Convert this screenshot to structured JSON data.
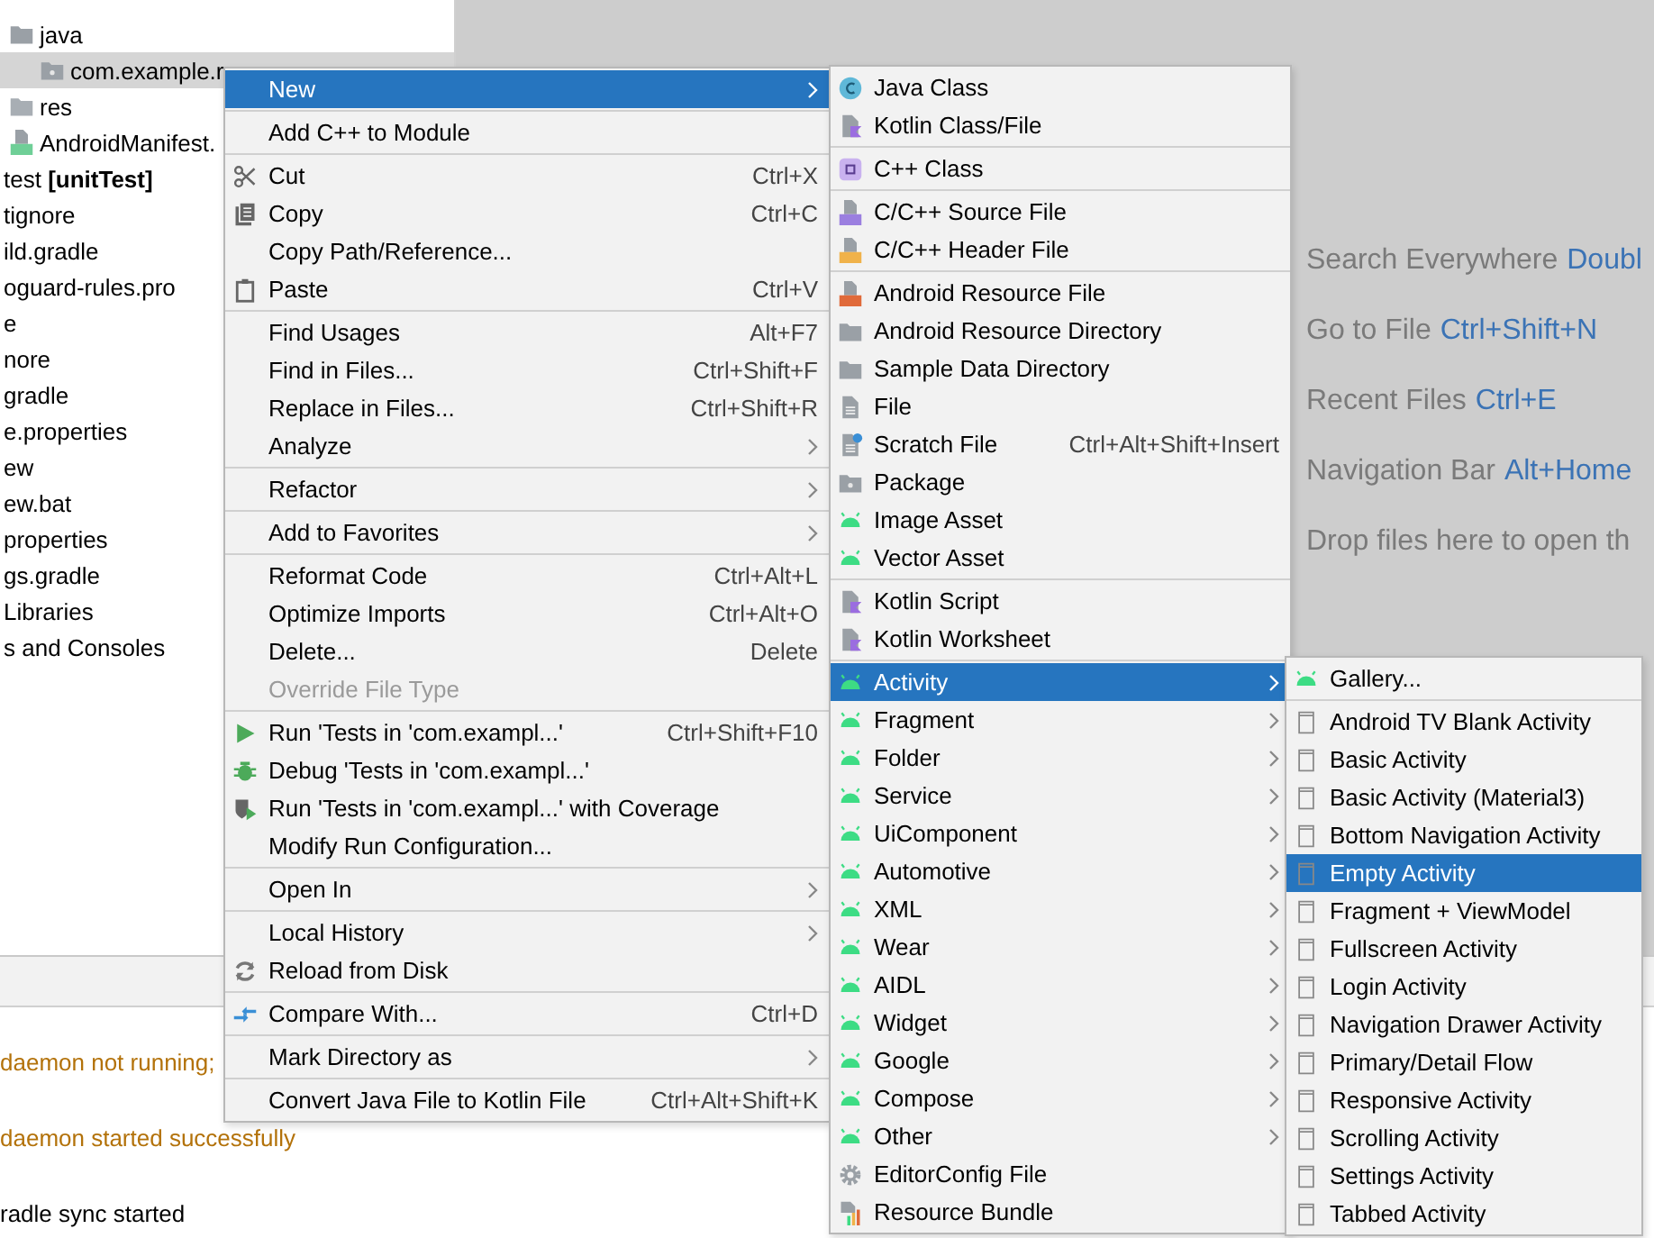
{
  "project_tree": {
    "items": [
      {
        "label": "java",
        "kind": "folder",
        "selected": false,
        "children": [
          {
            "label": "com.example.r",
            "kind": "package",
            "selected": true
          }
        ]
      },
      {
        "label": "res",
        "kind": "resfolder",
        "selected": false
      },
      {
        "label": "AndroidManifest.",
        "kind": "manifest",
        "selected": false
      },
      {
        "label": "test **[unitTest]**",
        "selected": false
      },
      {
        "label": "tignore",
        "selected": false
      },
      {
        "label": "ild.gradle",
        "selected": false
      },
      {
        "label": "oguard-rules.pro",
        "selected": false
      },
      {
        "label": "e",
        "selected": false
      },
      {
        "label": "nore",
        "selected": false
      },
      {
        "label": "gradle",
        "selected": false
      },
      {
        "label": "e.properties",
        "selected": false
      },
      {
        "label": "ew",
        "selected": false
      },
      {
        "label": "ew.bat",
        "selected": false
      },
      {
        "label": "properties",
        "selected": false
      },
      {
        "label": "gs.gradle",
        "selected": false
      },
      {
        "label": "Libraries",
        "selected": false
      },
      {
        "label": "s and Consoles",
        "selected": false
      }
    ]
  },
  "editor_hints": [
    {
      "label": "Search Everywhere",
      "shortcut": "Doubl"
    },
    {
      "label": "Go to File",
      "shortcut": "Ctrl+Shift+N"
    },
    {
      "label": "Recent Files",
      "shortcut": "Ctrl+E"
    },
    {
      "label": "Navigation Bar",
      "shortcut": "Alt+Home"
    },
    {
      "label": "Drop files here to open th"
    }
  ],
  "build_output": {
    "lines": [
      {
        "text": "daemon not running;",
        "kind": "warning"
      },
      {
        "text": "daemon started successfully",
        "kind": "warning"
      },
      {
        "text": "radle sync started",
        "kind": "plain"
      }
    ]
  },
  "context_menu": {
    "items": [
      {
        "kind": "none",
        "label": "New",
        "submenu": true,
        "selected": true,
        "disabled": false
      },
      {
        "kind": "separator"
      },
      {
        "kind": "none",
        "label": "Add C++ to Module",
        "submenu": false,
        "selected": false,
        "disabled": false
      },
      {
        "kind": "separator"
      },
      {
        "kind": "scissors",
        "label": "Cut",
        "shortcut": "Ctrl+X",
        "submenu": false,
        "selected": false,
        "disabled": false
      },
      {
        "kind": "copy",
        "label": "Copy",
        "shortcut": "Ctrl+C",
        "submenu": false,
        "selected": false,
        "disabled": false
      },
      {
        "kind": "none",
        "label": "Copy Path/Reference...",
        "submenu": false,
        "selected": false,
        "disabled": false
      },
      {
        "kind": "clipboard",
        "label": "Paste",
        "shortcut": "Ctrl+V",
        "submenu": false,
        "selected": false,
        "disabled": false
      },
      {
        "kind": "separator"
      },
      {
        "kind": "none",
        "label": "Find Usages",
        "shortcut": "Alt+F7",
        "submenu": false,
        "selected": false,
        "disabled": false
      },
      {
        "kind": "none",
        "label": "Find in Files...",
        "shortcut": "Ctrl+Shift+F",
        "submenu": false,
        "selected": false,
        "disabled": false
      },
      {
        "kind": "none",
        "label": "Replace in Files...",
        "shortcut": "Ctrl+Shift+R",
        "submenu": false,
        "selected": false,
        "disabled": false
      },
      {
        "kind": "none",
        "label": "Analyze",
        "submenu": true,
        "selected": false,
        "disabled": false
      },
      {
        "kind": "separator"
      },
      {
        "kind": "none",
        "label": "Refactor",
        "submenu": true,
        "selected": false,
        "disabled": false
      },
      {
        "kind": "separator"
      },
      {
        "kind": "none",
        "label": "Add to Favorites",
        "submenu": true,
        "selected": false,
        "disabled": false
      },
      {
        "kind": "separator"
      },
      {
        "kind": "none",
        "label": "Reformat Code",
        "shortcut": "Ctrl+Alt+L",
        "submenu": false,
        "selected": false,
        "disabled": false
      },
      {
        "kind": "none",
        "label": "Optimize Imports",
        "shortcut": "Ctrl+Alt+O",
        "submenu": false,
        "selected": false,
        "disabled": false
      },
      {
        "kind": "none",
        "label": "Delete...",
        "shortcut": "Delete",
        "submenu": false,
        "selected": false,
        "disabled": false
      },
      {
        "kind": "none",
        "label": "Override File Type",
        "submenu": false,
        "selected": false,
        "disabled": true
      },
      {
        "kind": "separator"
      },
      {
        "kind": "run",
        "label": "Run 'Tests in 'com.exampl...'",
        "shortcut": "Ctrl+Shift+F10",
        "submenu": false,
        "selected": false,
        "disabled": false
      },
      {
        "kind": "bug",
        "label": "Debug 'Tests in 'com.exampl...'",
        "submenu": false,
        "selected": false,
        "disabled": false
      },
      {
        "kind": "coverage",
        "label": "Run 'Tests in 'com.exampl...' with Coverage",
        "submenu": false,
        "selected": false,
        "disabled": false
      },
      {
        "kind": "none",
        "label": "Modify Run Configuration...",
        "submenu": false,
        "selected": false,
        "disabled": false
      },
      {
        "kind": "separator"
      },
      {
        "kind": "none",
        "label": "Open In",
        "submenu": true,
        "selected": false,
        "disabled": false
      },
      {
        "kind": "separator"
      },
      {
        "kind": "none",
        "label": "Local History",
        "submenu": true,
        "selected": false,
        "disabled": false
      },
      {
        "kind": "reload",
        "label": "Reload from Disk",
        "submenu": false,
        "selected": false,
        "disabled": false
      },
      {
        "kind": "separator"
      },
      {
        "kind": "compare",
        "label": "Compare With...",
        "shortcut": "Ctrl+D",
        "submenu": false,
        "selected": false,
        "disabled": false
      },
      {
        "kind": "separator"
      },
      {
        "kind": "none",
        "label": "Mark Directory as",
        "submenu": true,
        "selected": false,
        "disabled": false
      },
      {
        "kind": "separator"
      },
      {
        "kind": "none",
        "label": "Convert Java File to Kotlin File",
        "shortcut": "Ctrl+Alt+Shift+K",
        "submenu": false,
        "selected": false,
        "disabled": false
      }
    ]
  },
  "new_submenu": {
    "items": [
      {
        "kind": "javaclass",
        "label": "Java Class",
        "submenu": false,
        "selected": false
      },
      {
        "kind": "kotlin",
        "label": "Kotlin Class/File",
        "submenu": false,
        "selected": false
      },
      {
        "kind": "separator"
      },
      {
        "kind": "cppclass",
        "label": "C++ Class",
        "submenu": false,
        "selected": false
      },
      {
        "kind": "separator"
      },
      {
        "kind": "cppsource",
        "label": "C/C++ Source File",
        "submenu": false,
        "selected": false
      },
      {
        "kind": "cppheader",
        "label": "C/C++ Header File",
        "submenu": false,
        "selected": false
      },
      {
        "kind": "separator"
      },
      {
        "kind": "resfile",
        "label": "Android Resource File",
        "submenu": false,
        "selected": false
      },
      {
        "kind": "folder",
        "label": "Android Resource Directory",
        "submenu": false,
        "selected": false
      },
      {
        "kind": "folder",
        "label": "Sample Data Directory",
        "submenu": false,
        "selected": false
      },
      {
        "kind": "file",
        "label": "File",
        "submenu": false,
        "selected": false
      },
      {
        "kind": "scratch",
        "label": "Scratch File",
        "shortcut": "Ctrl+Alt+Shift+Insert",
        "submenu": false,
        "selected": false
      },
      {
        "kind": "package",
        "label": "Package",
        "submenu": false,
        "selected": false
      },
      {
        "kind": "android",
        "label": "Image Asset",
        "submenu": false,
        "selected": false
      },
      {
        "kind": "android",
        "label": "Vector Asset",
        "submenu": false,
        "selected": false
      },
      {
        "kind": "separator"
      },
      {
        "kind": "kotlin",
        "label": "Kotlin Script",
        "submenu": false,
        "selected": false
      },
      {
        "kind": "kotlin",
        "label": "Kotlin Worksheet",
        "submenu": false,
        "selected": false
      },
      {
        "kind": "separator"
      },
      {
        "kind": "android",
        "label": "Activity",
        "submenu": true,
        "selected": true
      },
      {
        "kind": "android",
        "label": "Fragment",
        "submenu": true,
        "selected": false
      },
      {
        "kind": "android",
        "label": "Folder",
        "submenu": true,
        "selected": false
      },
      {
        "kind": "android",
        "label": "Service",
        "submenu": true,
        "selected": false
      },
      {
        "kind": "android",
        "label": "UiComponent",
        "submenu": true,
        "selected": false
      },
      {
        "kind": "android",
        "label": "Automotive",
        "submenu": true,
        "selected": false
      },
      {
        "kind": "android",
        "label": "XML",
        "submenu": true,
        "selected": false
      },
      {
        "kind": "android",
        "label": "Wear",
        "submenu": true,
        "selected": false
      },
      {
        "kind": "android",
        "label": "AIDL",
        "submenu": true,
        "selected": false
      },
      {
        "kind": "android",
        "label": "Widget",
        "submenu": true,
        "selected": false
      },
      {
        "kind": "android",
        "label": "Google",
        "submenu": true,
        "selected": false
      },
      {
        "kind": "android",
        "label": "Compose",
        "submenu": true,
        "selected": false
      },
      {
        "kind": "android",
        "label": "Other",
        "submenu": true,
        "selected": false
      },
      {
        "kind": "gear",
        "label": "EditorConfig File",
        "submenu": false,
        "selected": false
      },
      {
        "kind": "bundle",
        "label": "Resource Bundle",
        "submenu": false,
        "selected": false
      }
    ]
  },
  "activity_submenu": {
    "items": [
      {
        "kind": "android",
        "label": "Gallery...",
        "selected": false
      },
      {
        "kind": "separator"
      },
      {
        "kind": "layout",
        "label": "Android TV Blank Activity",
        "selected": false
      },
      {
        "kind": "layout",
        "label": "Basic Activity",
        "selected": false
      },
      {
        "kind": "layout",
        "label": "Basic Activity (Material3)",
        "selected": false
      },
      {
        "kind": "layout",
        "label": "Bottom Navigation Activity",
        "selected": false
      },
      {
        "kind": "layout",
        "label": "Empty Activity",
        "selected": true
      },
      {
        "kind": "layout",
        "label": "Fragment + ViewModel",
        "selected": false
      },
      {
        "kind": "layout",
        "label": "Fullscreen Activity",
        "selected": false
      },
      {
        "kind": "layout",
        "label": "Login Activity",
        "selected": false
      },
      {
        "kind": "layout",
        "label": "Navigation Drawer Activity",
        "selected": false
      },
      {
        "kind": "layout",
        "label": "Primary/Detail Flow",
        "selected": false
      },
      {
        "kind": "layout",
        "label": "Responsive Activity",
        "selected": false
      },
      {
        "kind": "layout",
        "label": "Scrolling Activity",
        "selected": false
      },
      {
        "kind": "layout",
        "label": "Settings Activity",
        "selected": false
      },
      {
        "kind": "layout",
        "label": "Tabbed Activity",
        "selected": false
      }
    ]
  }
}
